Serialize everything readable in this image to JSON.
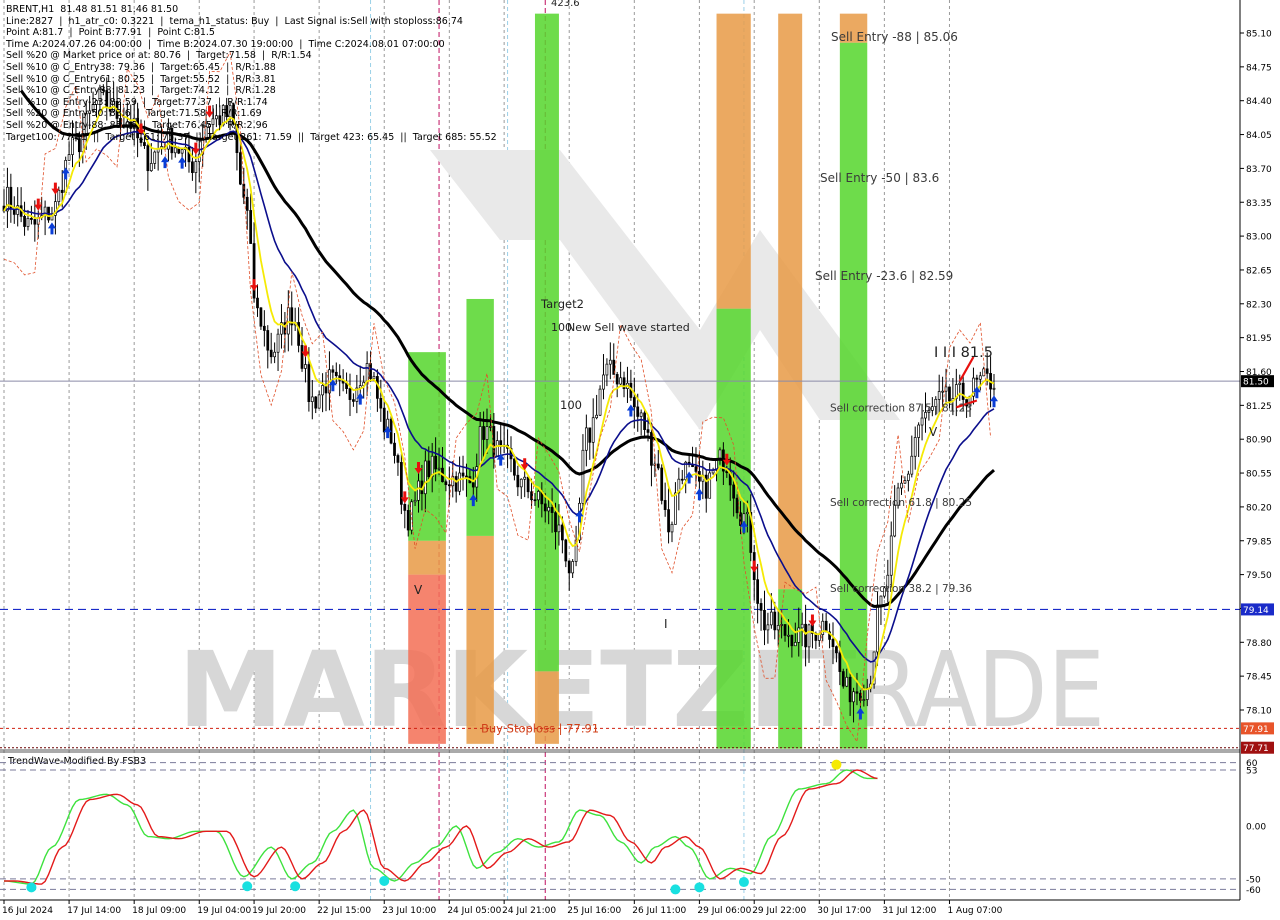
{
  "header": {
    "symbol": "BRENT,H1  81.48 81.51 81.46 81.50",
    "lines": [
      "Line:2827  |  h1_atr_c0: 0.3221  |  tema_h1_status: Buy  |  Last Signal is:Sell with stoploss:86.74",
      "Point A:81.7  |  Point B:77.91  |  Point C:81.5",
      "Time A:2024.07.26 04:00:00  |  Time B:2024.07.30 19:00:00  |  Time C:2024.08.01 07:00:00",
      "Sell %20 @ Market price or at: 80.76  |  Target:71.58  |  R/R:1.54",
      "Sell %10 @ C_Entry38: 79.36  |  Target:65.45  |  R/R:1.88",
      "Sell %10 @ C_Entry61: 80.25  |  Target:55.52  |  R/R:3.81",
      "Sell %10 @ C_Entry88: 81.23  |  Target:74.12  |  R/R:1.28",
      "Sell %10 @ Entry-23: 82.59  |  Target:77.37  |  R/R:1.74",
      "Sell %20 @ Entry-50: 83.6  |  Target:71.58  |  R/R:1.69",
      "Sell %20 @ Entry-88: 85.06  |  Target:76.45  |  R/R:2.96",
      "Target100: 77.71  ||  Target 161: 75.37  ||  Target 261: 71.59  ||  Target 423: 65.45  ||  Target 685: 55.52"
    ]
  },
  "watermark": {
    "text_left": "MARKETZI",
    "text_right": "TRADE"
  },
  "colors": {
    "green": "#55d62b",
    "orange": "#e89a45",
    "red_orange": "#f36f55",
    "blue_line": "#0b0e8c",
    "yellow_line": "#f5ea05",
    "black_line": "#000000",
    "arrow_up": "#0a3dd6",
    "arrow_down": "#e8100e",
    "level_blue": "#1a2bc9",
    "level_red": "#d02010",
    "osc_red": "#e31a1a",
    "osc_green": "#3ee23e",
    "cyan_dot": "#19e0e0"
  },
  "chart_data": [
    {
      "type": "candlestick",
      "title": "BRENT,H1",
      "y_axis_side": "right",
      "ylim": [
        77.7,
        85.25
      ],
      "y_ticks": [
        "85.10",
        "84.75",
        "84.40",
        "84.05",
        "83.70",
        "83.35",
        "83.00",
        "82.65",
        "82.30",
        "81.95",
        "81.60",
        "81.25",
        "80.90",
        "80.55",
        "80.20",
        "79.85",
        "79.50",
        "79.15",
        "78.80",
        "78.45",
        "78.10"
      ],
      "x_tick_labels": [
        "16 Jul 2024",
        "17 Jul 14:00",
        "18 Jul 09:00",
        "19 Jul 04:00",
        "19 Jul 20:00",
        "22 Jul 15:00",
        "23 Jul 10:00",
        "24 Jul 05:00",
        "24 Jul 21:00",
        "25 Jul 16:00",
        "26 Jul 11:00",
        "29 Jul 06:00",
        "29 Jul 22:00",
        "30 Jul 17:00",
        "31 Jul 12:00",
        "1 Aug 07:00"
      ],
      "x_tick_index": [
        0,
        19,
        38,
        57,
        73,
        92,
        111,
        130,
        146,
        165,
        184,
        203,
        219,
        238,
        257,
        276
      ],
      "bar_count": 290,
      "close_path_anchors": [
        [
          0,
          83.4
        ],
        [
          8,
          83.1
        ],
        [
          14,
          83.25
        ],
        [
          20,
          83.9
        ],
        [
          28,
          84.4
        ],
        [
          36,
          84.2
        ],
        [
          42,
          83.8
        ],
        [
          48,
          84.0
        ],
        [
          55,
          83.75
        ],
        [
          60,
          84.2
        ],
        [
          66,
          84.25
        ],
        [
          70,
          83.4
        ],
        [
          74,
          82.2
        ],
        [
          78,
          81.8
        ],
        [
          84,
          82.2
        ],
        [
          90,
          81.3
        ],
        [
          95,
          81.5
        ],
        [
          100,
          81.35
        ],
        [
          106,
          81.65
        ],
        [
          112,
          81.0
        ],
        [
          118,
          80.1
        ],
        [
          124,
          80.6
        ],
        [
          130,
          80.5
        ],
        [
          136,
          80.45
        ],
        [
          140,
          81.0
        ],
        [
          146,
          80.7
        ],
        [
          152,
          80.4
        ],
        [
          158,
          80.2
        ],
        [
          162,
          79.95
        ],
        [
          166,
          79.5
        ],
        [
          170,
          80.9
        ],
        [
          176,
          81.6
        ],
        [
          180,
          81.55
        ],
        [
          186,
          81.1
        ],
        [
          190,
          80.7
        ],
        [
          194,
          80.0
        ],
        [
          198,
          80.6
        ],
        [
          204,
          80.4
        ],
        [
          210,
          80.7
        ],
        [
          216,
          80.1
        ],
        [
          222,
          79.0
        ],
        [
          228,
          78.9
        ],
        [
          234,
          78.85
        ],
        [
          240,
          79.0
        ],
        [
          246,
          78.3
        ],
        [
          252,
          78.35
        ],
        [
          256,
          79.2
        ],
        [
          262,
          80.4
        ],
        [
          268,
          81.1
        ],
        [
          274,
          81.3
        ],
        [
          280,
          81.35
        ],
        [
          286,
          81.5
        ],
        [
          289,
          81.5
        ]
      ],
      "price_labels": {
        "current": {
          "value": 81.5,
          "text": "81.50"
        },
        "entry_level": {
          "value": 79.14,
          "text": "79.14"
        },
        "stoploss": {
          "value": 77.91,
          "text": "77.91"
        },
        "target100": {
          "value": 77.71,
          "text": "77.71"
        }
      },
      "zone_labels": [
        {
          "text": "Sell Entry -88 | 85.06",
          "price": 85.06
        },
        {
          "text": "Sell Entry -50 | 83.6",
          "price": 83.6
        },
        {
          "text": "Sell Entry -23.6 | 82.59",
          "price": 82.59
        },
        {
          "text": "Sell correction 87.5 | 81.23",
          "price": 81.23
        },
        {
          "text": "Sell correction 61.8 | 80.25",
          "price": 80.25
        },
        {
          "text": "Sell correction 38.2 | 79.36",
          "price": 79.36
        },
        {
          "text": "Buy Stoploss | 77.91",
          "price": 77.91
        }
      ],
      "chart_texts": [
        "Target2",
        "100",
        "New Sell wave started",
        "100",
        "I I I 81.5",
        "V",
        "V",
        "I",
        "423.6"
      ],
      "zones": [
        {
          "from": 118,
          "to": 129,
          "segments": [
            [
              77.75,
              79.5,
              "red_orange"
            ],
            [
              79.5,
              79.85,
              "orange"
            ],
            [
              79.85,
              81.8,
              "green"
            ]
          ]
        },
        {
          "from": 135,
          "to": 143,
          "segments": [
            [
              77.75,
              79.9,
              "orange"
            ],
            [
              79.9,
              82.35,
              "green"
            ]
          ]
        },
        {
          "from": 155,
          "to": 162,
          "segments": [
            [
              77.75,
              78.5,
              "orange"
            ],
            [
              78.5,
              85.3,
              "green"
            ]
          ]
        },
        {
          "from": 208,
          "to": 218,
          "segments": [
            [
              77.7,
              82.25,
              "green"
            ],
            [
              82.25,
              85.3,
              "orange"
            ]
          ]
        },
        {
          "from": 226,
          "to": 233,
          "segments": [
            [
              77.7,
              79.35,
              "green"
            ],
            [
              79.35,
              85.3,
              "orange"
            ]
          ]
        },
        {
          "from": 244,
          "to": 252,
          "segments": [
            [
              77.7,
              85.0,
              "green"
            ],
            [
              85.0,
              85.3,
              "orange"
            ]
          ]
        }
      ]
    },
    {
      "type": "line",
      "title": "TrendWave-Modified By FSB3",
      "ylim": [
        -70,
        70
      ],
      "y_ticks": [
        "60",
        "53",
        "0.00",
        "-50",
        "-60"
      ],
      "levels": [
        60,
        53,
        -50,
        -60
      ],
      "series": [
        {
          "name": "fast",
          "color": "osc_green"
        },
        {
          "name": "slow",
          "color": "osc_red"
        }
      ],
      "anchors": [
        [
          0,
          -52
        ],
        [
          8,
          -55
        ],
        [
          14,
          -20
        ],
        [
          22,
          25
        ],
        [
          30,
          30
        ],
        [
          36,
          20
        ],
        [
          42,
          -10
        ],
        [
          48,
          -12
        ],
        [
          56,
          -5
        ],
        [
          62,
          -5
        ],
        [
          70,
          -48
        ],
        [
          78,
          -20
        ],
        [
          84,
          -50
        ],
        [
          90,
          -35
        ],
        [
          96,
          -5
        ],
        [
          102,
          15
        ],
        [
          108,
          -40
        ],
        [
          114,
          -52
        ],
        [
          120,
          -35
        ],
        [
          126,
          -20
        ],
        [
          132,
          0
        ],
        [
          138,
          -40
        ],
        [
          144,
          -25
        ],
        [
          150,
          -12
        ],
        [
          156,
          -20
        ],
        [
          162,
          -15
        ],
        [
          168,
          15
        ],
        [
          174,
          10
        ],
        [
          180,
          -15
        ],
        [
          186,
          -35
        ],
        [
          190,
          -20
        ],
        [
          196,
          -10
        ],
        [
          200,
          -20
        ],
        [
          206,
          -50
        ],
        [
          212,
          -40
        ],
        [
          218,
          -45
        ],
        [
          224,
          -10
        ],
        [
          232,
          35
        ],
        [
          240,
          40
        ],
        [
          246,
          53
        ],
        [
          252,
          45
        ]
      ],
      "dots": [
        [
          8,
          -58
        ],
        [
          71,
          -57
        ],
        [
          85,
          -57
        ],
        [
          111,
          -52
        ],
        [
          196,
          -60
        ],
        [
          203,
          -58
        ],
        [
          216,
          -53
        ],
        [
          243,
          58
        ]
      ]
    }
  ]
}
